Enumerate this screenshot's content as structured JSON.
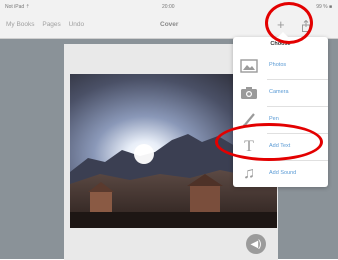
{
  "statusbar": {
    "carrier": "Not iPad ⇡",
    "time": "20:00",
    "battery": "99 % ■"
  },
  "nav": {
    "my_books": "My Books",
    "pages": "Pages",
    "undo": "Undo",
    "title": "Cover",
    "add_symbol": "+"
  },
  "popover": {
    "title": "Choose",
    "items": [
      {
        "label": "Photos",
        "icon": "photos-icon"
      },
      {
        "label": "Camera",
        "icon": "camera-icon"
      },
      {
        "label": "Pen",
        "icon": "pen-icon"
      },
      {
        "label": "Add Text",
        "icon": "text-icon",
        "glyph": "T"
      },
      {
        "label": "Add Sound",
        "icon": "music-note-icon",
        "glyph": "♫"
      }
    ]
  },
  "sound_glyph": "◀)",
  "colors": {
    "annotation": "#e30000",
    "accent": "#5b9bd5"
  }
}
